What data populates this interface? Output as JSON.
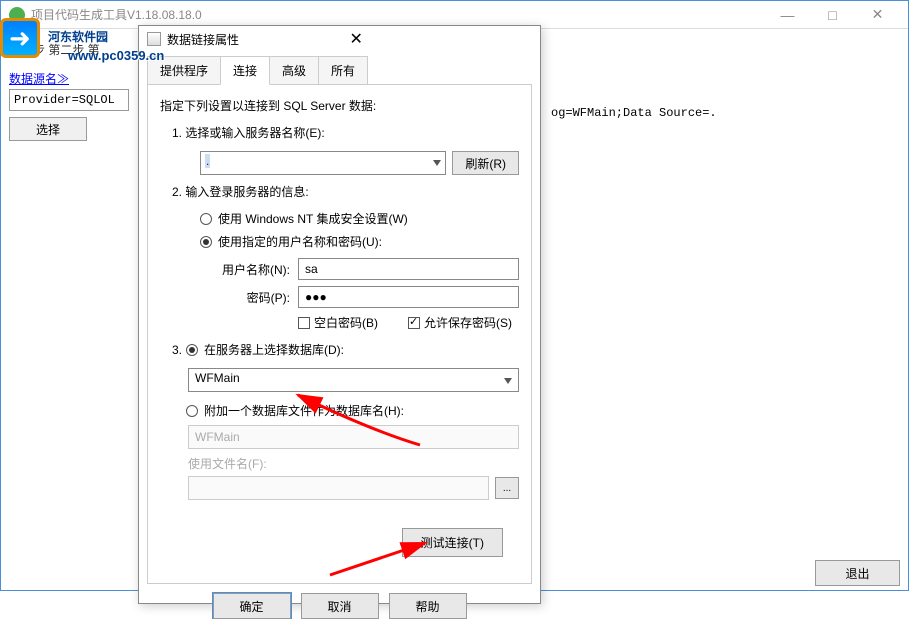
{
  "mainWindow": {
    "title": "项目代码生成工具V1.18.08.18.0",
    "bgTabs": "第一步   第二步   第",
    "sourceLabel": "数据源名≫",
    "sourceValue": "Provider=SQLOL",
    "sourceValueFull": "og=WFMain;Data Source=.",
    "selectBtn": "选择",
    "exitBtn": "退出"
  },
  "watermark": {
    "cn": "河东软件园",
    "url": "www.pc0359.cn"
  },
  "dialog": {
    "title": "数据链接属性",
    "tabs": [
      "提供程序",
      "连接",
      "高级",
      "所有"
    ],
    "intro": "指定下列设置以连接到 SQL Server 数据:",
    "item1": "1. 选择或输入服务器名称(E):",
    "serverValue": ".",
    "refreshBtn": "刷新(R)",
    "item2": "2. 输入登录服务器的信息:",
    "radioNT": "使用 Windows NT 集成安全设置(W)",
    "radioUser": "使用指定的用户名称和密码(U):",
    "userLabel": "用户名称(N):",
    "userValue": "sa",
    "pwdLabel": "密码(P):",
    "pwdValue": "●●●",
    "blankPwd": "空白密码(B)",
    "allowSave": "允许保存密码(S)",
    "item3": "3.",
    "radioDb": "在服务器上选择数据库(D):",
    "dbValue": "WFMain",
    "radioFile": "附加一个数据库文件作为数据库名(H):",
    "fileDbName": "WFMain",
    "fileLabel": "使用文件名(F):",
    "browseBtn": "...",
    "testBtn": "测试连接(T)",
    "okBtn": "确定",
    "cancelBtn": "取消",
    "helpBtn": "帮助"
  }
}
